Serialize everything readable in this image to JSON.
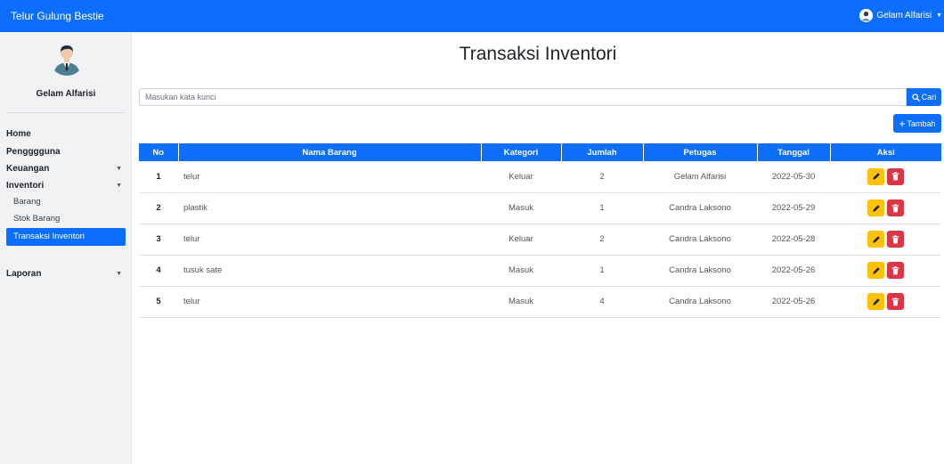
{
  "navbar": {
    "brand": "Telur Gulung Bestie",
    "user_name": "Gelam Alfarisi"
  },
  "sidebar": {
    "profile_name": "Gelam Alfarisi",
    "menu": {
      "home": "Home",
      "pengguna": "Pengggguna",
      "keuangan": "Keuangan",
      "inventori": "Inventori",
      "laporan": "Laporan"
    },
    "inventori_sub": {
      "barang": "Barang",
      "stok_barang": "Stok Barang",
      "transaksi": "Transaksi Inventori"
    },
    "active_item": "Transaksi Inventori"
  },
  "page": {
    "title": "Transaksi Inventori",
    "search_placeholder": "Masukan kata kunci",
    "search_button": "Cari",
    "add_button": "Tambah"
  },
  "table": {
    "headers": {
      "no": "No",
      "nama": "Nama Barang",
      "kategori": "Kategori",
      "jumlah": "Jumlah",
      "petugas": "Petugas",
      "tanggal": "Tanggal",
      "aksi": "Aksi"
    },
    "rows": [
      {
        "no": "1",
        "nama": "telur",
        "kategori": "Keluar",
        "jumlah": "2",
        "petugas": "Gelam Alfarisi",
        "tanggal": "2022-05-30"
      },
      {
        "no": "2",
        "nama": "plastik",
        "kategori": "Masuk",
        "jumlah": "1",
        "petugas": "Candra Laksono",
        "tanggal": "2022-05-29"
      },
      {
        "no": "3",
        "nama": "telur",
        "kategori": "Keluar",
        "jumlah": "2",
        "petugas": "Candra Laksono",
        "tanggal": "2022-05-28"
      },
      {
        "no": "4",
        "nama": "tusuk sate",
        "kategori": "Masuk",
        "jumlah": "1",
        "petugas": "Candra Laksono",
        "tanggal": "2022-05-26"
      },
      {
        "no": "5",
        "nama": "telur",
        "kategori": "Masuk",
        "jumlah": "4",
        "petugas": "Candra Laksono",
        "tanggal": "2022-05-26"
      }
    ]
  },
  "colors": {
    "primary": "#0d6efd",
    "warning": "#ffc107",
    "danger": "#dc3545",
    "sidebar_bg": "#f1f2f4"
  },
  "icons": {
    "user_avatar": "user-avatar-icon",
    "search": "search-icon",
    "plus": "plus-icon",
    "edit": "pencil-icon",
    "delete": "trash-icon",
    "dropdown": "caret-down-icon"
  }
}
